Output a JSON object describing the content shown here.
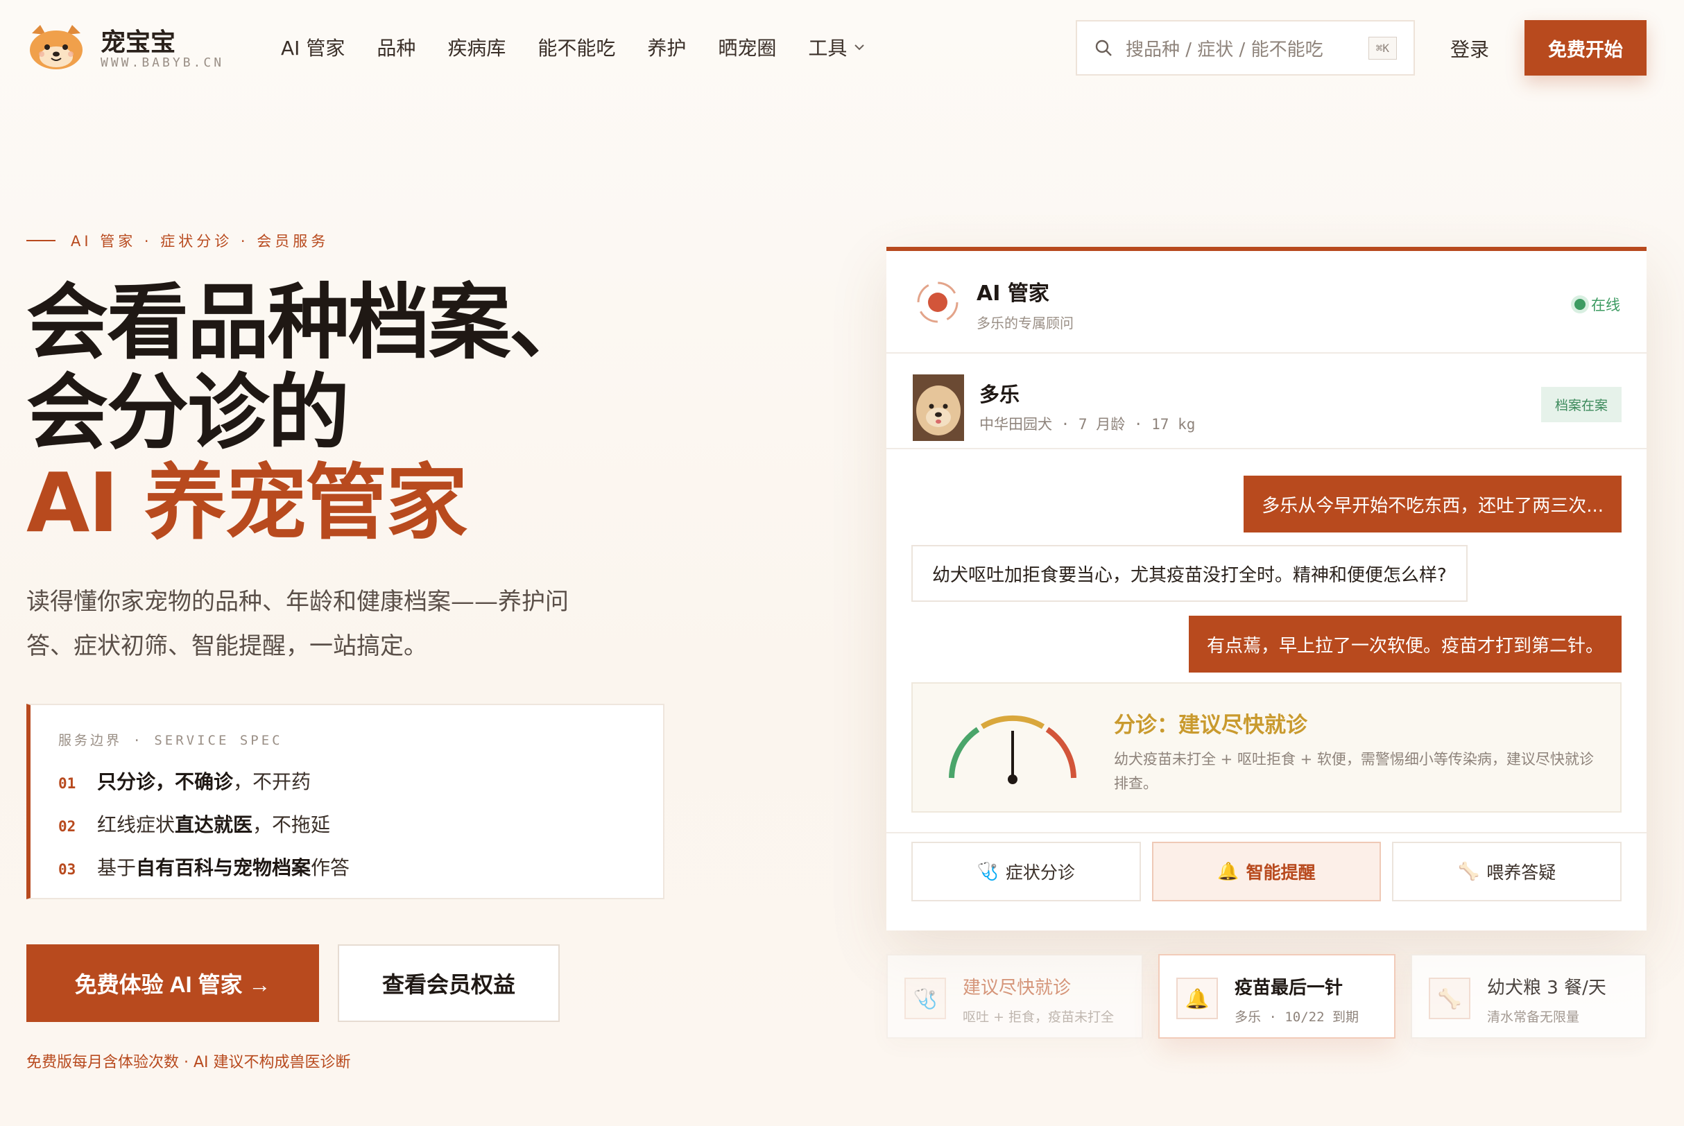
{
  "brand": {
    "name": "宠宝宝",
    "url": "WWW.BABYB.CN"
  },
  "nav": {
    "items": [
      "AI 管家",
      "品种",
      "疾病库",
      "能不能吃",
      "养护",
      "晒宠圈",
      "工具"
    ]
  },
  "search": {
    "placeholder": "搜品种 / 症状 / 能不能吃",
    "shortcut": "⌘K"
  },
  "header": {
    "login": "登录",
    "start": "免费开始"
  },
  "hero": {
    "eyebrow": "AI 管家 · 症状分诊 · 会员服务",
    "title_line1": "会看品种档案、",
    "title_line2": "会分诊的",
    "title_line3": "AI 养宠管家",
    "lead": "读得懂你家宠物的品种、年龄和健康档案——养护问答、症状初筛、智能提醒，一站搞定。",
    "spec_title": "服务边界 · SERVICE SPEC",
    "spec": [
      {
        "num": "01",
        "pre": "",
        "bold": "只分诊，不确诊",
        "post": "，不开药"
      },
      {
        "num": "02",
        "pre": "红线症状",
        "bold": "直达就医",
        "post": "，不拖延"
      },
      {
        "num": "03",
        "pre": "基于",
        "bold": "自有百科与宠物档案",
        "post": "作答"
      }
    ],
    "cta_primary": "免费体验 AI 管家 →",
    "cta_secondary": "查看会员权益",
    "footnote": "免费版每月含体验次数 · AI 建议不构成兽医诊断"
  },
  "chat": {
    "title": "AI 管家",
    "subtitle": "多乐的专属顾问",
    "status": "在线",
    "pet": {
      "name": "多乐",
      "meta": "中华田园犬 · 7 月龄 · 17 kg",
      "badge": "档案在案"
    },
    "messages": [
      {
        "role": "user",
        "text": "多乐从今早开始不吃东西，还吐了两三次..."
      },
      {
        "role": "ai",
        "text": "幼犬呕吐加拒食要当心，尤其疫苗没打全时。精神和便便怎么样?"
      },
      {
        "role": "user",
        "text": "有点蔫，早上拉了一次软便。疫苗才打到第二针。"
      }
    ],
    "triage": {
      "title": "分诊：建议尽快就诊",
      "desc": "幼犬疫苗未打全 + 呕吐拒食 + 软便，需警惕细小等传染病，建议尽快就诊排查。",
      "level": 0.5
    },
    "tabs": [
      {
        "label": "症状分诊",
        "icon": "stethoscope-icon"
      },
      {
        "label": "智能提醒",
        "icon": "bell-icon"
      },
      {
        "label": "喂养答疑",
        "icon": "bone-icon"
      }
    ]
  },
  "reminders": [
    {
      "title": "建议尽快就诊",
      "sub": "呕吐 + 拒食，疫苗未打全",
      "icon": "stethoscope-icon"
    },
    {
      "title": "疫苗最后一针",
      "sub": "多乐 · 10/22 到期",
      "icon": "bell-icon"
    },
    {
      "title": "幼犬粮 3 餐/天",
      "sub": "清水常备无限量",
      "icon": "bone-icon"
    }
  ],
  "colors": {
    "accent": "#b84a1e",
    "success": "#3d9b62",
    "warning": "#c99a2e"
  }
}
